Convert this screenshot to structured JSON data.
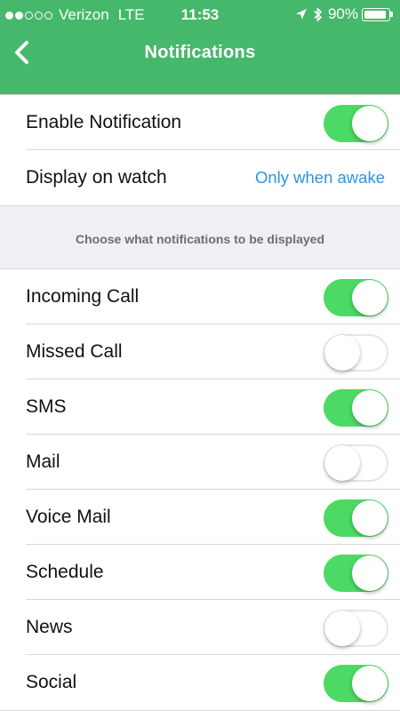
{
  "statusbar": {
    "carrier": "Verizon",
    "network": "LTE",
    "time": "11:53",
    "battery": "90%",
    "battery_level": 0.9,
    "signal_bars_filled": 2,
    "signal_bars_total": 5
  },
  "header": {
    "title": "Notifications",
    "color": "#46b86b"
  },
  "general": [
    {
      "label": "Enable Notification",
      "type": "toggle",
      "on": true
    },
    {
      "label": "Display on watch",
      "type": "value",
      "value": "Only when awake"
    }
  ],
  "section_note": "Choose what notifications to be displayed",
  "notifications": [
    {
      "label": "Incoming Call",
      "on": true
    },
    {
      "label": "Missed Call",
      "on": false
    },
    {
      "label": "SMS",
      "on": true
    },
    {
      "label": "Mail",
      "on": false
    },
    {
      "label": "Voice Mail",
      "on": true
    },
    {
      "label": "Schedule",
      "on": true
    },
    {
      "label": "News",
      "on": false
    },
    {
      "label": "Social",
      "on": true
    }
  ],
  "colors": {
    "toggle_on": "#4cd964",
    "link": "#2b95e6"
  }
}
